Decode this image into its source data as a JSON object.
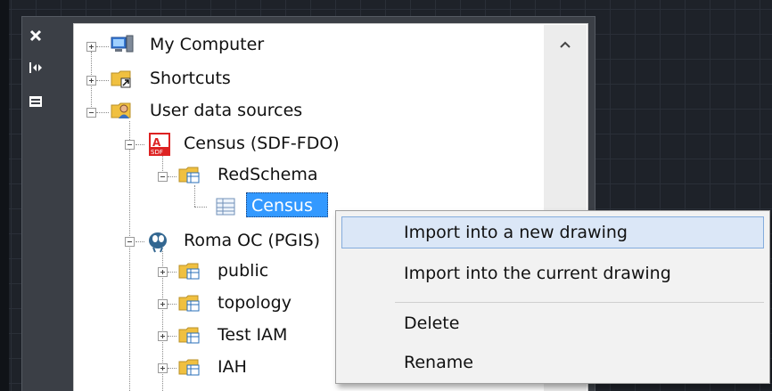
{
  "palette": {
    "close_icon": "close-icon",
    "autohide_icon": "auto-hide-icon",
    "properties_icon": "properties-icon"
  },
  "tree": {
    "items": [
      {
        "label": "My Computer",
        "icon": "computer-icon"
      },
      {
        "label": "Shortcuts",
        "icon": "shortcut-folder-icon"
      },
      {
        "label": "User data sources",
        "icon": "user-folder-icon"
      },
      {
        "label": "Census (SDF-FDO)",
        "icon": "sdf-icon"
      },
      {
        "label": "RedSchema",
        "icon": "schema-folder-icon"
      },
      {
        "label": "Census",
        "icon": "table-icon"
      },
      {
        "label": "Roma OC (PGIS)",
        "icon": "postgis-icon"
      },
      {
        "label": "public",
        "icon": "schema-folder-icon"
      },
      {
        "label": "topology",
        "icon": "schema-folder-icon"
      },
      {
        "label": "Test IAM",
        "icon": "schema-folder-icon"
      },
      {
        "label": "IAH",
        "icon": "schema-folder-icon"
      }
    ]
  },
  "context_menu": {
    "items": [
      {
        "label": "Import into a new drawing"
      },
      {
        "label": "Import into the current drawing"
      },
      {
        "label": "Delete"
      },
      {
        "label": "Rename"
      }
    ]
  },
  "colors": {
    "selection": "#3399ff",
    "menu_hover": "#dbe7f7",
    "background": "#1e2229"
  }
}
